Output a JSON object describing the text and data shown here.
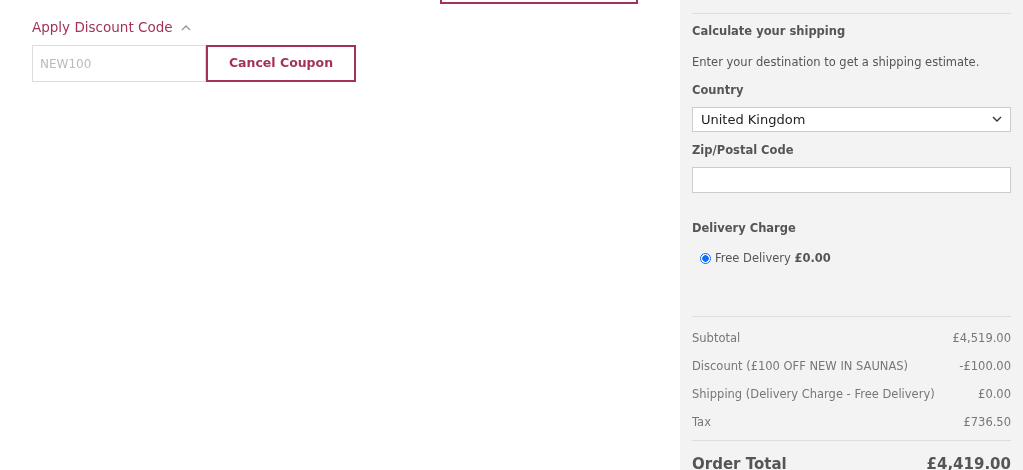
{
  "discount": {
    "toggle_label": "Apply Discount Code",
    "expanded": true,
    "code_field": {
      "value": "NEW100",
      "disabled": true
    },
    "cancel_button": "Cancel Coupon"
  },
  "top_button": {
    "kind": "outline"
  },
  "shipping": {
    "heading": "Calculate your shipping",
    "intro": "Enter your destination to get a shipping estimate.",
    "country_label": "Country",
    "country_value": "United Kingdom",
    "zip_label": "Zip/Postal Code",
    "delivery_heading": "Delivery Charge",
    "delivery_options": [
      {
        "label": "Free Delivery **£0.00**",
        "selected": true
      }
    ]
  },
  "totals": [
    {
      "label": "Subtotal",
      "value": "£4,519.00"
    },
    {
      "label": "Discount (£100 OFF NEW IN SAUNAS)",
      "value": "-£100.00"
    },
    {
      "label": "Shipping (Delivery Charge - Free Delivery)",
      "value": "£0.00"
    },
    {
      "label": "Tax",
      "value": "£736.50"
    }
  ],
  "order_total": {
    "label": "Order Total",
    "value": "£4,419.00"
  }
}
